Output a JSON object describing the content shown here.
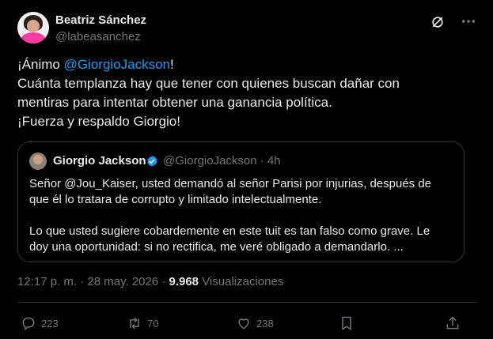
{
  "author": {
    "name": "Beatriz Sánchez",
    "handle": "@labeasanchez"
  },
  "tweet": {
    "line1_pre": "¡Ánimo ",
    "line1_mention": "@GiorgioJackson",
    "line1_post": "!",
    "line2": "Cuánta templanza hay que tener con quienes buscan dañar con",
    "line3": "mentiras para intentar obtener una ganancia política.",
    "line4": "¡Fuerza y respaldo Giorgio!"
  },
  "quote": {
    "name": "Giorgio Jackson",
    "handle_time": "@GiorgioJackson · 4h",
    "para1": "Señor @Jou_Kaiser, usted demandó al señor Parisi por injurias, después de que él lo tratara de corrupto y limitado intelectualmente.",
    "para2": "Lo que usted sugiere cobardemente en este tuit es tan falso como grave. Le doy una oportunidad: si no rectifica, me veré obligado a demandarlo. ..."
  },
  "meta": {
    "timestamp": "12:17 p. m. · 28 may. 2026 · ",
    "views_count": "9.968",
    "views_label": " Visualizaciones"
  },
  "actions": {
    "replies": "223",
    "reposts": "70",
    "likes": "238"
  },
  "colors": {
    "background": "#000000",
    "text": "#e7e9ea",
    "muted": "#71767b",
    "link": "#1d9bf0",
    "border": "#2f3336",
    "verified": "#1d9bf0"
  },
  "icons": [
    "grok-icon",
    "more-icon",
    "verified-badge-icon",
    "reply-icon",
    "repost-icon",
    "like-icon",
    "bookmark-icon",
    "share-icon"
  ]
}
